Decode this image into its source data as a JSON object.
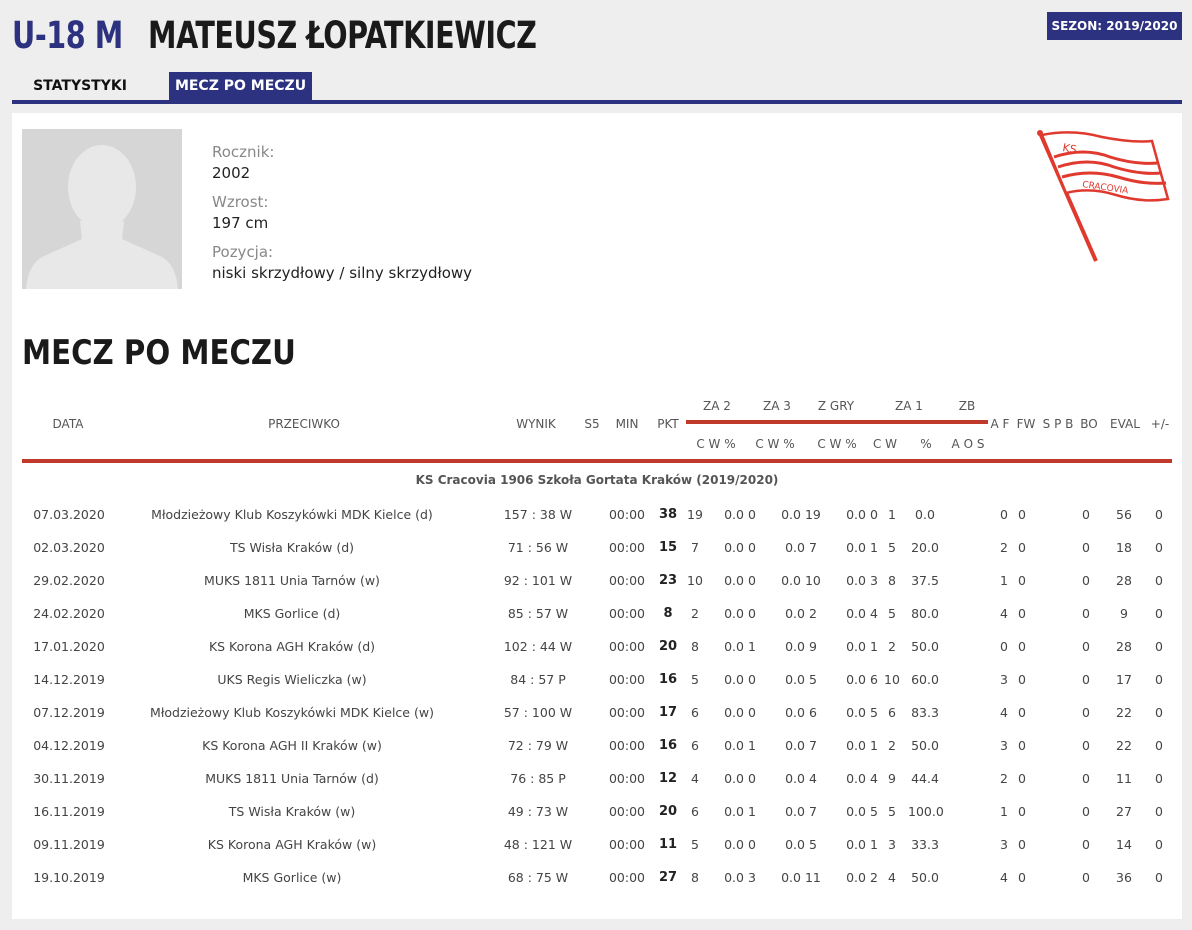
{
  "header": {
    "category": "U-18 M",
    "player_name": "MATEUSZ ŁOPATKIEWICZ",
    "season": "SEZON: 2019/2020"
  },
  "tabs": [
    {
      "label": "STATYSTYKI",
      "active": false
    },
    {
      "label": "MECZ PO MECZU",
      "active": true
    }
  ],
  "profile": {
    "rocznik_label": "Rocznik:",
    "rocznik": "2002",
    "wzrost_label": "Wzrost:",
    "wzrost": "197 cm",
    "pozycja_label": "Pozycja:",
    "pozycja": "niski skrzydłowy / silny skrzydłowy",
    "logo_text_top": "KS",
    "logo_text_bottom": "CRACOVIA"
  },
  "section_title": "MECZ PO MECZU",
  "table": {
    "headers": {
      "data": "DATA",
      "przeciwko": "PRZECIWKO",
      "wynik": "WYNIK",
      "s5": "S5",
      "min": "MIN",
      "pkt": "PKT",
      "za2": "ZA 2",
      "za3": "ZA 3",
      "zgry": "Z GRY",
      "za1": "ZA 1",
      "zb": "ZB",
      "af": "A F",
      "fw": "FW",
      "spb": "S P B",
      "bo": "BO",
      "eval": "EVAL",
      "pm": "+/-",
      "sub_za2": "C  W  %",
      "sub_za3": "C W  %",
      "sub_zgry": "C  W  %",
      "sub_za1": "C  W",
      "sub_za1_pct": "%",
      "sub_zb": "A O S"
    },
    "team_label": "KS Cracovia 1906 Szkoła Gortata Kraków (2019/2020)",
    "rows": [
      {
        "date": "07.03.2020",
        "opp": "Młodzieżowy Klub Koszykówki MDK Kielce (d)",
        "wynik": "157 : 38 W",
        "min": "00:00",
        "pkt": "38",
        "a": "19",
        "b": "0.0 0",
        "c": "0.0 19",
        "d": "0.0 0",
        "e": "1",
        "f": "0.0",
        "g": "0",
        "h": "0",
        "i": "0",
        "eval": "56",
        "pm": "0"
      },
      {
        "date": "02.03.2020",
        "opp": "TS Wisła Kraków (d)",
        "wynik": "71 : 56 W",
        "min": "00:00",
        "pkt": "15",
        "a": "7",
        "b": "0.0 0",
        "c": "0.0 7",
        "d": "0.0 1",
        "e": "5",
        "f": "20.0",
        "g": "2",
        "h": "0",
        "i": "0",
        "eval": "18",
        "pm": "0"
      },
      {
        "date": "29.02.2020",
        "opp": "MUKS 1811 Unia Tarnów (w)",
        "wynik": "92 : 101 W",
        "min": "00:00",
        "pkt": "23",
        "a": "10",
        "b": "0.0 0",
        "c": "0.0 10",
        "d": "0.0 3",
        "e": "8",
        "f": "37.5",
        "g": "1",
        "h": "0",
        "i": "0",
        "eval": "28",
        "pm": "0"
      },
      {
        "date": "24.02.2020",
        "opp": "MKS Gorlice (d)",
        "wynik": "85 : 57 W",
        "min": "00:00",
        "pkt": "8",
        "a": "2",
        "b": "0.0 0",
        "c": "0.0 2",
        "d": "0.0 4",
        "e": "5",
        "f": "80.0",
        "g": "4",
        "h": "0",
        "i": "0",
        "eval": "9",
        "pm": "0"
      },
      {
        "date": "17.01.2020",
        "opp": "KS Korona AGH Kraków (d)",
        "wynik": "102 : 44 W",
        "min": "00:00",
        "pkt": "20",
        "a": "8",
        "b": "0.0 1",
        "c": "0.0 9",
        "d": "0.0 1",
        "e": "2",
        "f": "50.0",
        "g": "0",
        "h": "0",
        "i": "0",
        "eval": "28",
        "pm": "0"
      },
      {
        "date": "14.12.2019",
        "opp": "UKS Regis Wieliczka (w)",
        "wynik": "84 : 57 P",
        "min": "00:00",
        "pkt": "16",
        "a": "5",
        "b": "0.0 0",
        "c": "0.0 5",
        "d": "0.0 6",
        "e": "10",
        "f": "60.0",
        "g": "3",
        "h": "0",
        "i": "0",
        "eval": "17",
        "pm": "0"
      },
      {
        "date": "07.12.2019",
        "opp": "Młodzieżowy Klub Koszykówki MDK Kielce (w)",
        "wynik": "57 : 100 W",
        "min": "00:00",
        "pkt": "17",
        "a": "6",
        "b": "0.0 0",
        "c": "0.0 6",
        "d": "0.0 5",
        "e": "6",
        "f": "83.3",
        "g": "4",
        "h": "0",
        "i": "0",
        "eval": "22",
        "pm": "0"
      },
      {
        "date": "04.12.2019",
        "opp": "KS Korona AGH II Kraków (w)",
        "wynik": "72 : 79 W",
        "min": "00:00",
        "pkt": "16",
        "a": "6",
        "b": "0.0 1",
        "c": "0.0 7",
        "d": "0.0 1",
        "e": "2",
        "f": "50.0",
        "g": "3",
        "h": "0",
        "i": "0",
        "eval": "22",
        "pm": "0"
      },
      {
        "date": "30.11.2019",
        "opp": "MUKS 1811 Unia Tarnów (d)",
        "wynik": "76 : 85 P",
        "min": "00:00",
        "pkt": "12",
        "a": "4",
        "b": "0.0 0",
        "c": "0.0 4",
        "d": "0.0 4",
        "e": "9",
        "f": "44.4",
        "g": "2",
        "h": "0",
        "i": "0",
        "eval": "11",
        "pm": "0"
      },
      {
        "date": "16.11.2019",
        "opp": "TS Wisła Kraków (w)",
        "wynik": "49 : 73 W",
        "min": "00:00",
        "pkt": "20",
        "a": "6",
        "b": "0.0 1",
        "c": "0.0 7",
        "d": "0.0 5",
        "e": "5",
        "f": "100.0",
        "g": "1",
        "h": "0",
        "i": "0",
        "eval": "27",
        "pm": "0"
      },
      {
        "date": "09.11.2019",
        "opp": "KS Korona AGH Kraków (w)",
        "wynik": "48 : 121 W",
        "min": "00:00",
        "pkt": "11",
        "a": "5",
        "b": "0.0 0",
        "c": "0.0 5",
        "d": "0.0 1",
        "e": "3",
        "f": "33.3",
        "g": "3",
        "h": "0",
        "i": "0",
        "eval": "14",
        "pm": "0"
      },
      {
        "date": "19.10.2019",
        "opp": "MKS Gorlice (w)",
        "wynik": "68 : 75 W",
        "min": "00:00",
        "pkt": "27",
        "a": "8",
        "b": "0.0 3",
        "c": "0.0 11",
        "d": "0.0 2",
        "e": "4",
        "f": "50.0",
        "g": "4",
        "h": "0",
        "i": "0",
        "eval": "36",
        "pm": "0"
      }
    ]
  },
  "colors": {
    "navy": "#2d3280",
    "red": "#c0392b"
  }
}
